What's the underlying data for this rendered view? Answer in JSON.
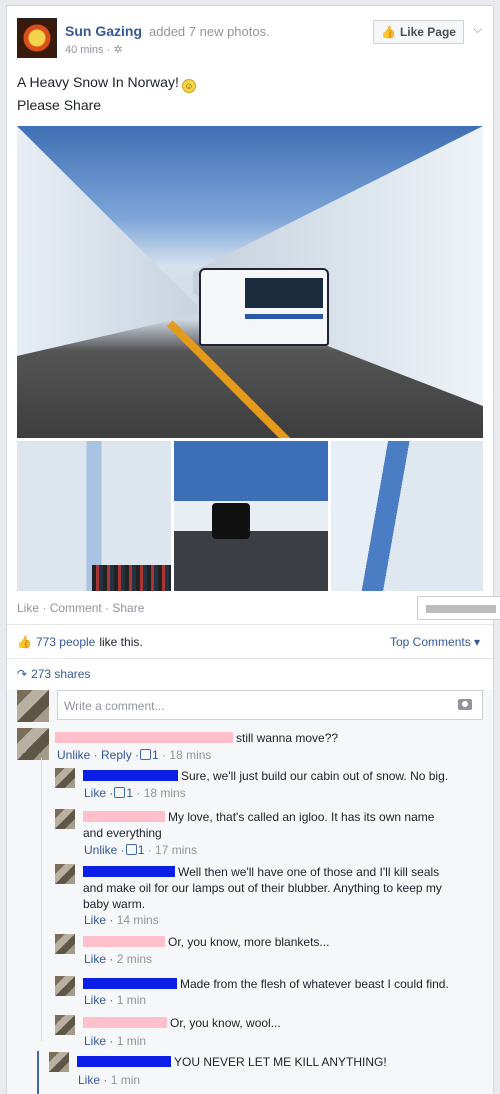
{
  "post": {
    "page_name": "Sun Gazing",
    "action": "added 7 new photos.",
    "time": "40 mins",
    "like_page_label": "Like Page",
    "text_line1": "A Heavy Snow In Norway!",
    "text_line2": "Please Share"
  },
  "actions": {
    "like": "Like",
    "comment": "Comment",
    "share": "Share"
  },
  "stats": {
    "likes_count": "773 people",
    "likes_suffix": "like this.",
    "top_comments": "Top Comments",
    "shares": "273 shares"
  },
  "comment_box": {
    "placeholder": "Write a comment..."
  },
  "comments": [
    {
      "text": "still wanna move??",
      "actions": "Unlike · Reply ·",
      "likes": "1",
      "time": "· 18 mins"
    },
    {
      "text": "Sure, we'll just build our cabin out of snow. No big.",
      "actions": "Like ·",
      "likes": "1",
      "time": "· 18 mins"
    },
    {
      "text": "My love, that's called an igloo. It has its own name",
      "text2": "and everything",
      "actions": "Unlike ·",
      "likes": "1",
      "time": "· 17 mins"
    },
    {
      "text": "Well then we'll have one of those and I'll kill seals",
      "text2": "and make oil for our lamps out of their blubber. Anything to keep my",
      "text3": "baby warm.",
      "actions": "Like ·",
      "time": "14 mins"
    },
    {
      "text": "Or, you know, more blankets...",
      "actions": "Like ·",
      "time": "2 mins"
    },
    {
      "text": "Made from the flesh of whatever beast I could find.",
      "actions": "Like ·",
      "time": "1 min"
    },
    {
      "text": "Or, you know, wool...",
      "actions": "Like ·",
      "time": "1 min"
    },
    {
      "text": "YOU NEVER LET ME KILL ANYTHING!",
      "actions": "Like ·",
      "time": "1 min"
    }
  ]
}
